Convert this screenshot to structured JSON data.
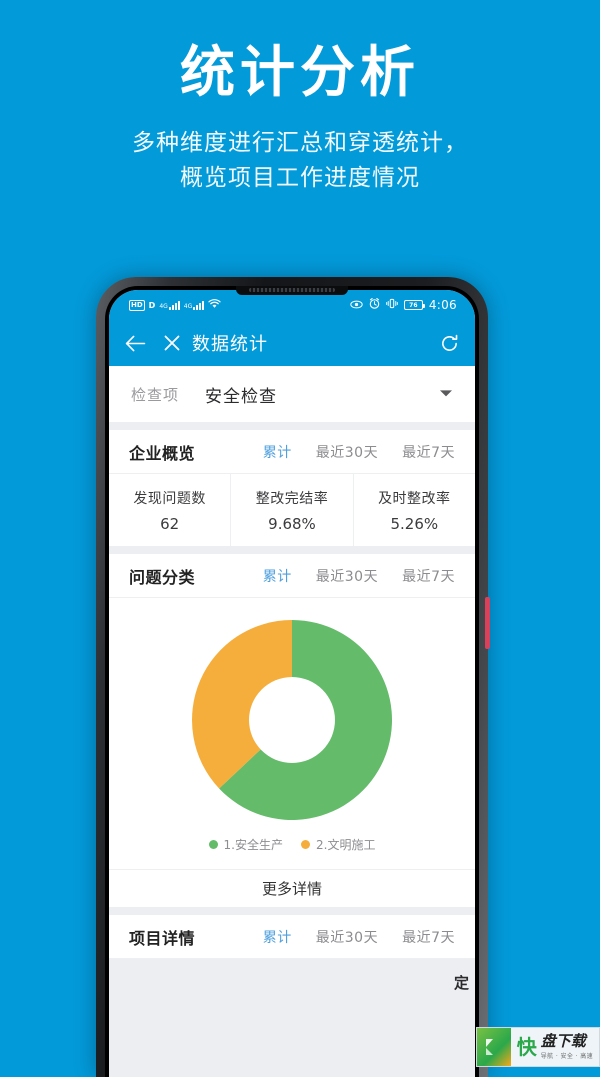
{
  "promo": {
    "title": "统计分析",
    "subtitle_line1": "多种维度进行汇总和穿透统计，",
    "subtitle_line2": "概览项目工作进度情况"
  },
  "colors": {
    "brand_blue": "#039ada",
    "accent_blue": "#4fa0de",
    "green": "#64bb6a",
    "orange": "#f5ae3c",
    "page_bg": "#eceef1"
  },
  "status_bar": {
    "hd_label": "HD",
    "data_label": "D",
    "network_1": "4G",
    "network_2": "4G",
    "wifi_icon": "wifi-icon",
    "eye_icon": "eye-icon",
    "alarm_icon": "alarm-icon",
    "vibrate_icon": "vibrate-icon",
    "battery_level": "76",
    "time": "4:06"
  },
  "app_bar": {
    "back_icon": "back-arrow-icon",
    "close_icon": "close-icon",
    "title": "数据统计",
    "refresh_icon": "refresh-icon"
  },
  "filter": {
    "label": "检查项",
    "value": "安全检查",
    "caret_icon": "chevron-down-icon"
  },
  "tabs": [
    "累计",
    "最近30天",
    "最近7天"
  ],
  "active_tab": "累计",
  "enterprise_overview": {
    "title": "企业概览",
    "stats": [
      {
        "label": "发现问题数",
        "value": "62"
      },
      {
        "label": "整改完结率",
        "value": "9.68%"
      },
      {
        "label": "及时整改率",
        "value": "5.26%"
      }
    ]
  },
  "problem_classification": {
    "title": "问题分类",
    "more_label": "更多详情"
  },
  "project_details": {
    "title": "项目详情",
    "table_first_header": "定"
  },
  "watermark": {
    "logo_glyph": "⌁",
    "kuai": "快",
    "main": "盘下载",
    "sub": "导航 · 安全 · 高速"
  },
  "chart_data": {
    "type": "pie",
    "variant": "donut",
    "title": "问题分类",
    "categories": [
      "1.安全生产",
      "2.文明施工"
    ],
    "values": [
      63,
      37
    ],
    "unit": "%",
    "colors": [
      "#64bb6a",
      "#f5ae3c"
    ],
    "legend_position": "bottom",
    "start_angle_deg": 0,
    "inner_radius_ratio": 0.42,
    "labels_shown": false
  }
}
